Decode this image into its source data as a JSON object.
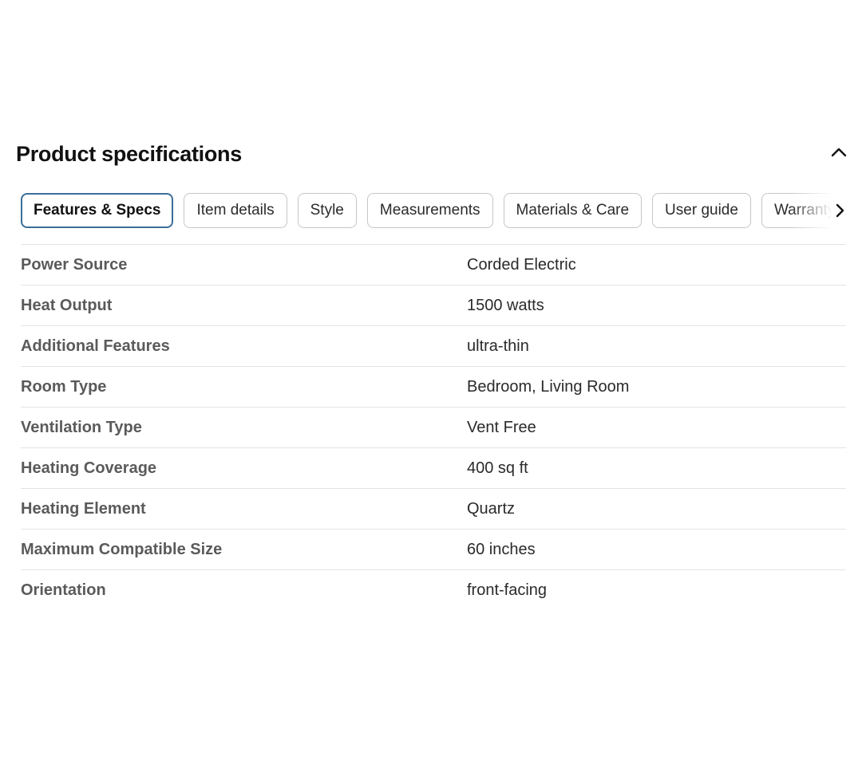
{
  "section": {
    "title": "Product specifications"
  },
  "tabs": [
    {
      "label": "Features & Specs",
      "active": true
    },
    {
      "label": "Item details",
      "active": false
    },
    {
      "label": "Style",
      "active": false
    },
    {
      "label": "Measurements",
      "active": false
    },
    {
      "label": "Materials & Care",
      "active": false
    },
    {
      "label": "User guide",
      "active": false
    },
    {
      "label": "Warranty",
      "active": false
    }
  ],
  "specs": [
    {
      "label": "Power Source",
      "value": "Corded Electric"
    },
    {
      "label": "Heat Output",
      "value": "1500 watts"
    },
    {
      "label": "Additional Features",
      "value": "ultra-thin"
    },
    {
      "label": "Room Type",
      "value": "Bedroom, Living Room"
    },
    {
      "label": "Ventilation Type",
      "value": "Vent Free"
    },
    {
      "label": "Heating Coverage",
      "value": "400 sq ft"
    },
    {
      "label": "Heating Element",
      "value": "Quartz"
    },
    {
      "label": "Maximum Compatible Size",
      "value": "60 inches"
    },
    {
      "label": "Orientation",
      "value": "front-facing"
    }
  ],
  "icons": {
    "collapse": "chevron-up-icon",
    "scroll_right": "chevron-right-icon"
  },
  "colors": {
    "active_tab_border": "#3b6e99",
    "tab_border": "#c6c6c6",
    "label_text": "#5a5a5a",
    "divider": "#e4e4e4"
  }
}
